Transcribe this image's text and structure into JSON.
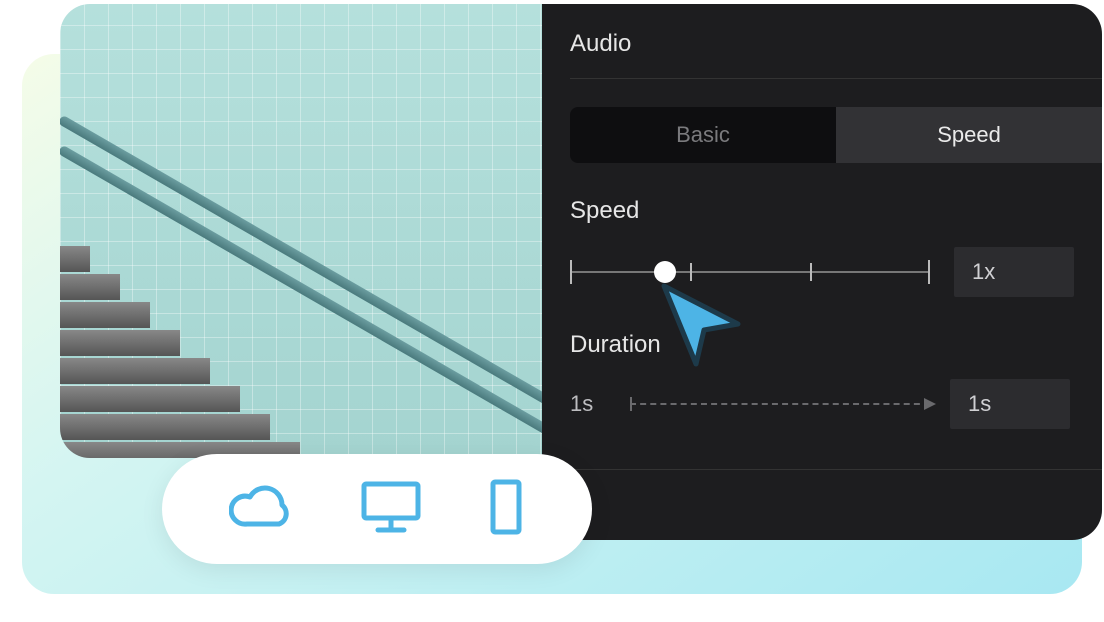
{
  "panel": {
    "title": "Audio",
    "tabs": {
      "inactive": "Basic",
      "active": "Speed"
    },
    "speed": {
      "label": "Speed",
      "value": "1x"
    },
    "duration": {
      "label": "Duration",
      "from": "1s",
      "to": "1s"
    }
  },
  "devices": {
    "icons": [
      "cloud-icon",
      "monitor-icon",
      "phone-icon"
    ]
  },
  "colors": {
    "icon_blue": "#4db4e6",
    "panel_bg": "#1d1d1f"
  }
}
